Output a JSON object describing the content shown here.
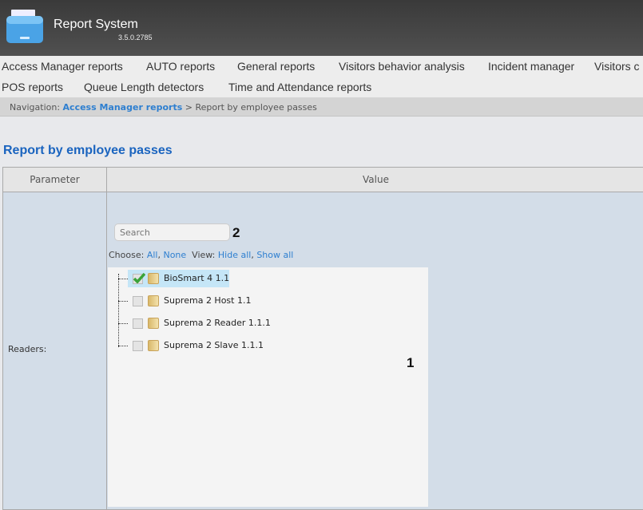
{
  "header": {
    "title": "Report System",
    "version": "3.5.0.2785",
    "logo_icon": "folder-icon"
  },
  "menu": {
    "row1": [
      "Access Manager reports",
      "AUTO reports",
      "General reports",
      "Visitors behavior analysis",
      "Incident manager",
      "Visitors c"
    ],
    "row2": [
      "POS reports",
      "Queue Length detectors",
      "Time and Attendance reports"
    ]
  },
  "nav": {
    "label": "Navigation:",
    "link": "Access Manager reports",
    "separator": ">",
    "current": "Report by employee passes"
  },
  "page": {
    "title": "Report by employee passes"
  },
  "table": {
    "col_param": "Parameter",
    "col_value": "Value",
    "row_label": "Readers:"
  },
  "search": {
    "placeholder": "Search"
  },
  "choose": {
    "label": "Choose:",
    "all": "All",
    "none": "None",
    "view_label": "View:",
    "hide_all": "Hide all",
    "show_all": "Show all"
  },
  "tree": [
    {
      "label": "BioSmart 4 1.1",
      "checked": true
    },
    {
      "label": "Suprema 2 Host 1.1",
      "checked": false
    },
    {
      "label": "Suprema 2 Reader 1.1.1",
      "checked": false
    },
    {
      "label": "Suprema 2 Slave 1.1.1",
      "checked": false
    }
  ],
  "annotations": {
    "one": "1",
    "two": "2"
  }
}
